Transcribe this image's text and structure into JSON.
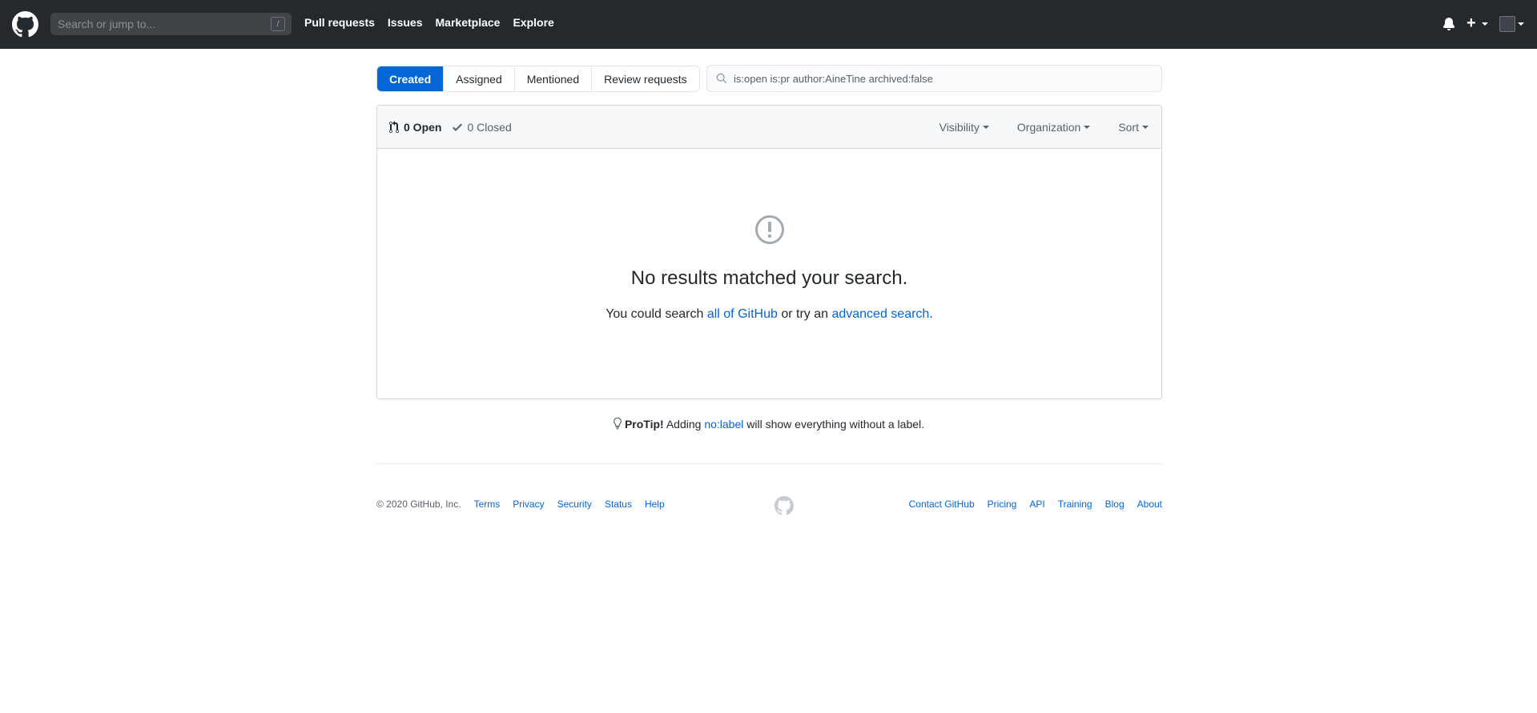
{
  "header": {
    "search_placeholder": "Search or jump to...",
    "slash_key": "/",
    "nav": [
      "Pull requests",
      "Issues",
      "Marketplace",
      "Explore"
    ],
    "plus_label": "+"
  },
  "subnav": {
    "tabs": [
      "Created",
      "Assigned",
      "Mentioned",
      "Review requests"
    ],
    "selected": "Created"
  },
  "filter": {
    "query": "is:open is:pr author:AineTine archived:false"
  },
  "states": {
    "open": "0 Open",
    "closed": "0 Closed"
  },
  "filters": [
    "Visibility",
    "Organization",
    "Sort"
  ],
  "blankslate": {
    "title": "No results matched your search.",
    "text_before": "You could search ",
    "link1": "all of GitHub",
    "text_middle": " or try an ",
    "link2": "advanced search",
    "text_after": "."
  },
  "protip": {
    "label": "ProTip!",
    "before": " Adding ",
    "link": "no:label",
    "after": " will show everything without a label."
  },
  "footer": {
    "copyright": "© 2020 GitHub, Inc.",
    "left_links": [
      "Terms",
      "Privacy",
      "Security",
      "Status",
      "Help"
    ],
    "right_links": [
      "Contact GitHub",
      "Pricing",
      "API",
      "Training",
      "Blog",
      "About"
    ]
  },
  "colors": {
    "header_bg": "#24292e",
    "accent": "#0366d6",
    "muted": "#586069"
  }
}
